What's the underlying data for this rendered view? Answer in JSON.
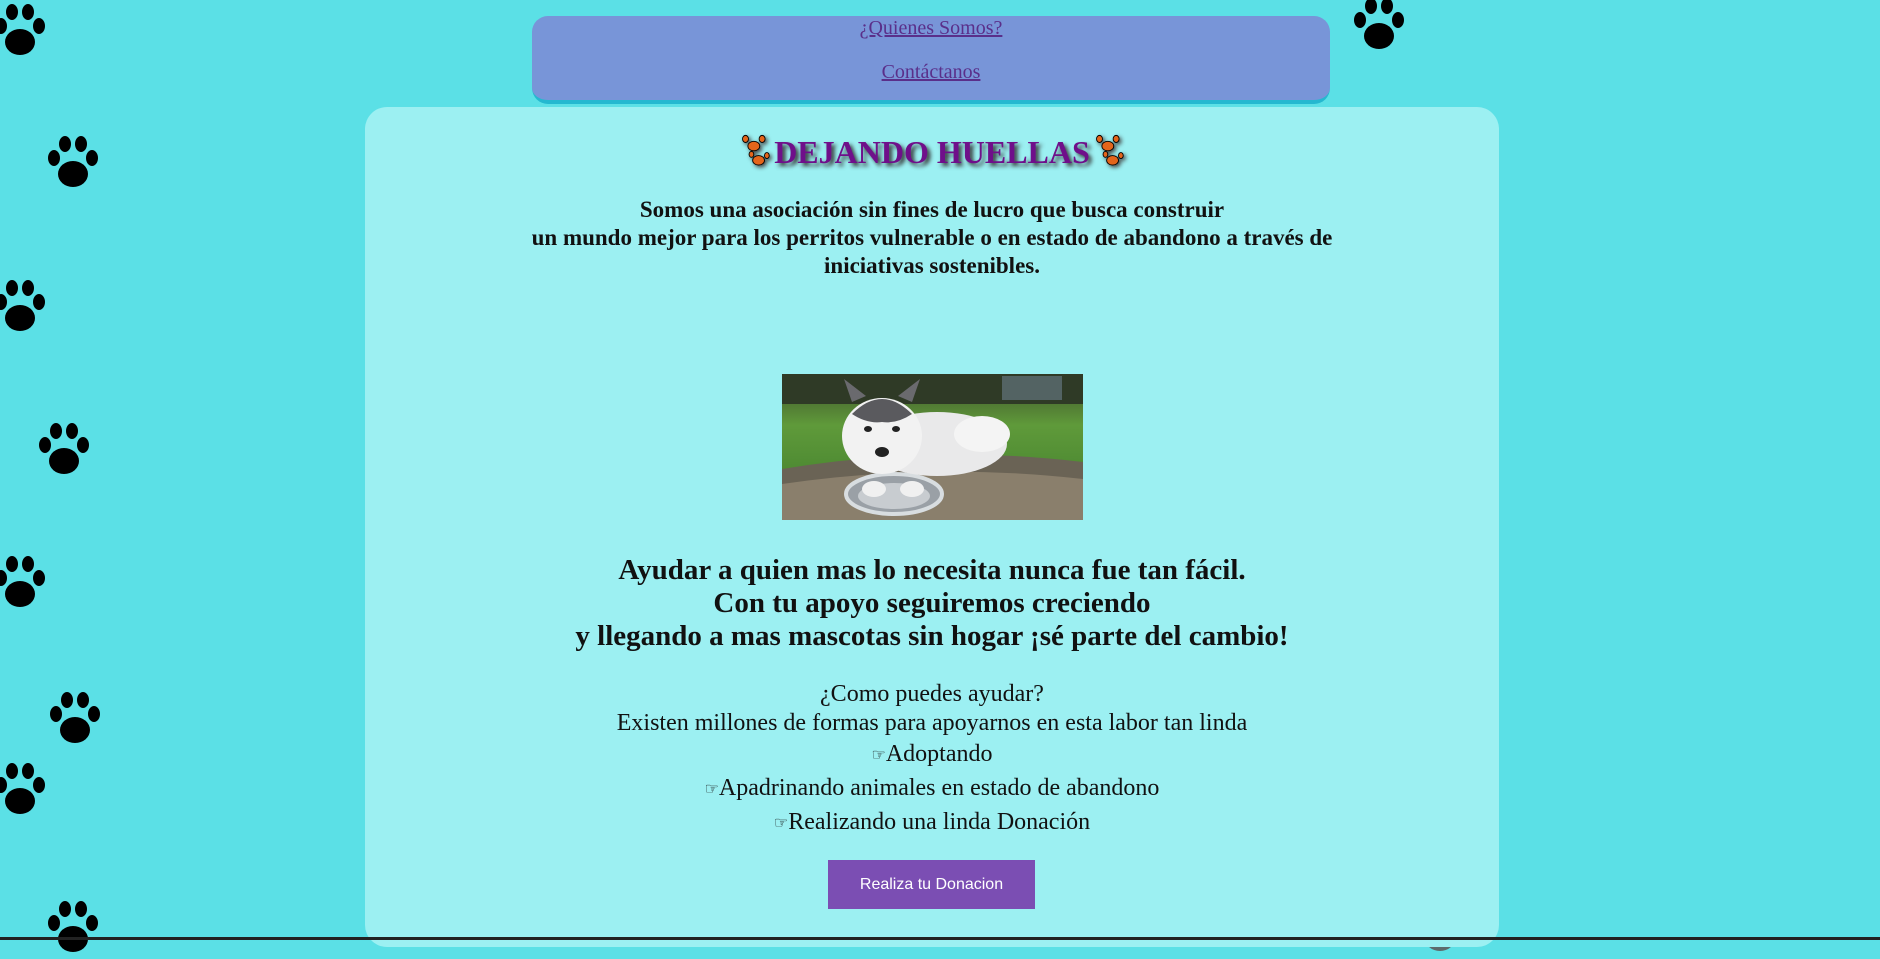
{
  "nav": {
    "about_label": "¿Quienes Somos?",
    "contact_label": "Contáctanos"
  },
  "main": {
    "title": "DEJANDO HUELLAS",
    "intro_line1": "Somos una asociación sin fines de lucro que busca construir",
    "intro_line2": "un mundo mejor para los perritos vulnerable o en estado de abandono a través de",
    "intro_line3": "iniciativas sostenibles.",
    "cta_line1": "Ayudar a quien mas lo necesita nunca fue tan fácil.",
    "cta_line2": "Con tu apoyo seguiremos creciendo",
    "cta_line3": "y llegando a mas mascotas sin hogar ¡sé parte del cambio!",
    "how_title": "¿Como puedes ayudar?",
    "how_subtitle": "Existen millones de formas para apoyarnos en esta labor tan linda",
    "bullet_symbol": "☞",
    "ways": [
      "Adoptando",
      "Apadrinando animales en estado de abandono",
      "Realizando una linda Donación"
    ],
    "donate_label": "Realiza tu Donacion"
  },
  "colors": {
    "background": "#5be0e6",
    "panel": "#9cf0f2",
    "nav": "#7895d8",
    "title": "#6f0f8a",
    "button": "#7b4eb3"
  },
  "icons": [
    "paw-icon",
    "puppy-photo"
  ]
}
